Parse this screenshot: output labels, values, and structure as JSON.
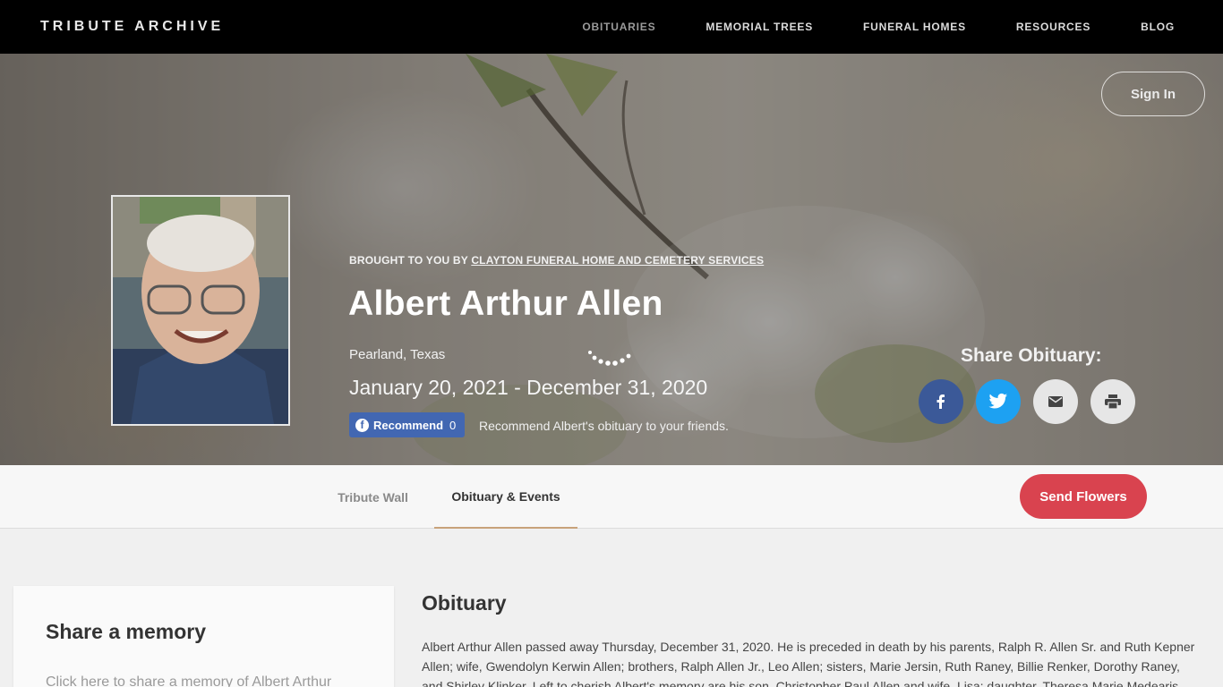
{
  "nav": {
    "brand": "TRIBUTE ARCHIVE",
    "links": [
      {
        "label": "OBITUARIES"
      },
      {
        "label": "MEMORIAL TREES"
      },
      {
        "label": "FUNERAL HOMES"
      },
      {
        "label": "RESOURCES"
      },
      {
        "label": "BLOG"
      }
    ]
  },
  "hero": {
    "signin_label": "Sign In",
    "brought_prefix": "BROUGHT TO YOU BY",
    "funeral_home": "CLAYTON FUNERAL HOME AND CEMETERY SERVICES",
    "name": "Albert Arthur Allen",
    "location": "Pearland, Texas",
    "dates": "January 20, 2021 - December 31, 2020",
    "recommend_label": "Recommend",
    "recommend_count": "0",
    "recommend_text": "Recommend Albert's obituary to your friends.",
    "share_title": "Share Obituary:"
  },
  "tabs": {
    "tribute_wall": "Tribute Wall",
    "obituary_events": "Obituary & Events",
    "send_flowers": "Send Flowers"
  },
  "memory": {
    "title": "Share a memory",
    "prompt": "Click here to share a memory of Albert Arthur"
  },
  "obituary": {
    "title": "Obituary",
    "text": "Albert Arthur Allen passed away Thursday, December 31, 2020. He is preceded in death by his parents, Ralph R. Allen Sr. and Ruth Kepner Allen; wife, Gwendolyn Kerwin Allen; brothers, Ralph Allen Jr., Leo Allen; sisters, Marie Jersin, Ruth Raney, Billie Renker, Dorothy Raney, and Shirley Klinker. Left to cherish Albert's memory are his son, Christopher Paul Allen and wife, Lisa; daughter, Theresa Marie Medearis and"
  },
  "colors": {
    "nav_bg": "#000000",
    "facebook": "#3b5998",
    "twitter": "#1da1f2",
    "send_flowers": "#d9434f",
    "tab_underline": "#c8a27a"
  }
}
